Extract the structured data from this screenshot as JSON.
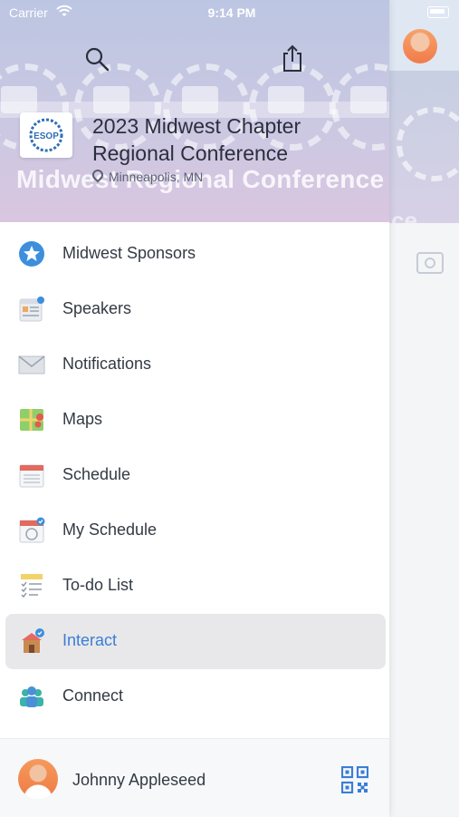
{
  "status_bar": {
    "carrier": "Carrier",
    "time": "9:14 PM"
  },
  "header": {
    "conference_title": "2023 Midwest Chapter Regional Conference",
    "location": "Minneapolis, MN",
    "banner_text": "Midwest Regional Conference",
    "logo_text": "ESOP"
  },
  "menu": {
    "items": [
      {
        "label": "Midwest Sponsors",
        "icon": "star-badge-icon"
      },
      {
        "label": "Speakers",
        "icon": "speakers-card-icon"
      },
      {
        "label": "Notifications",
        "icon": "envelope-icon"
      },
      {
        "label": "Maps",
        "icon": "map-icon"
      },
      {
        "label": "Schedule",
        "icon": "calendar-icon"
      },
      {
        "label": "My Schedule",
        "icon": "calendar-check-icon"
      },
      {
        "label": "To-do List",
        "icon": "checklist-icon"
      },
      {
        "label": "Interact",
        "icon": "interact-icon"
      },
      {
        "label": "Connect",
        "icon": "people-icon"
      }
    ],
    "active": "Interact"
  },
  "footer": {
    "user_name": "Johnny Appleseed"
  },
  "colors": {
    "accent": "#3b7ed6",
    "active_bg": "#e8e8ea",
    "star_blue": "#3d8fdc"
  }
}
